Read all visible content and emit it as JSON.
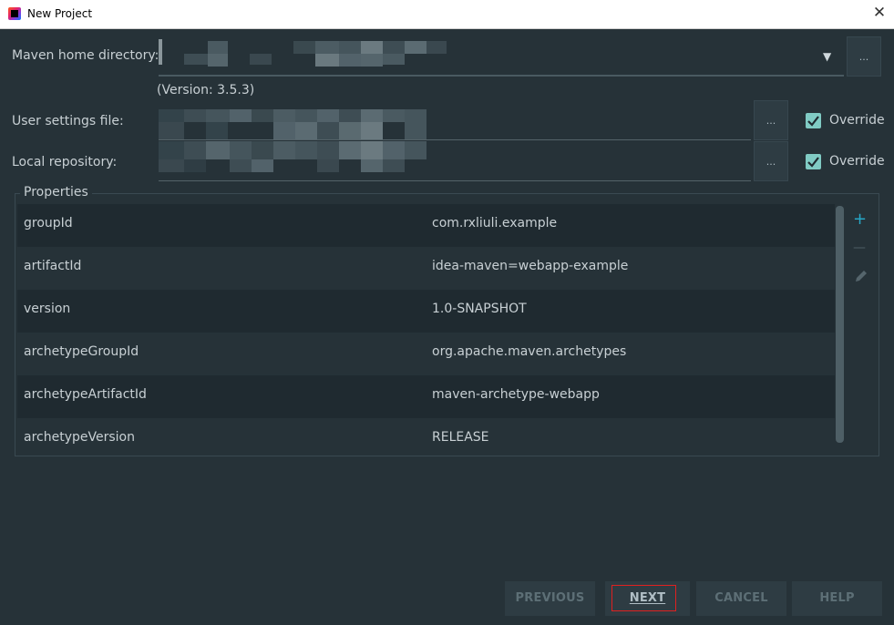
{
  "window": {
    "title": "New Project",
    "close_glyph": "✕",
    "icon": "intellij-idea-icon"
  },
  "maven": {
    "home_label": "Maven home directory:",
    "home_value": "",
    "version_text": "(Version: 3.5.3)",
    "user_settings_label": "User settings file:",
    "user_settings_value": "",
    "local_repo_label": "Local repository:",
    "local_repo_value": "",
    "browse_label": "...",
    "dropdown_glyph": "▼",
    "override_label": "Override",
    "user_settings_override": true,
    "local_repo_override": true
  },
  "properties": {
    "legend": "Properties",
    "rows": [
      {
        "key": "groupId",
        "value": "com.rxliuli.example"
      },
      {
        "key": "artifactId",
        "value": "idea-maven=webapp-example"
      },
      {
        "key": "version",
        "value": "1.0-SNAPSHOT"
      },
      {
        "key": "archetypeGroupId",
        "value": "org.apache.maven.archetypes"
      },
      {
        "key": "archetypeArtifactId",
        "value": "maven-archetype-webapp"
      },
      {
        "key": "archetypeVersion",
        "value": "RELEASE"
      }
    ],
    "add_glyph": "+",
    "remove_glyph": "—"
  },
  "buttons": {
    "previous": "PREVIOUS",
    "next": "NEXT",
    "cancel": "CANCEL",
    "help": "HELP"
  },
  "colors": {
    "background": "#263238",
    "accent": "#80cbc4",
    "add_icon": "#26a6c6",
    "focus_border": "#e02020"
  }
}
